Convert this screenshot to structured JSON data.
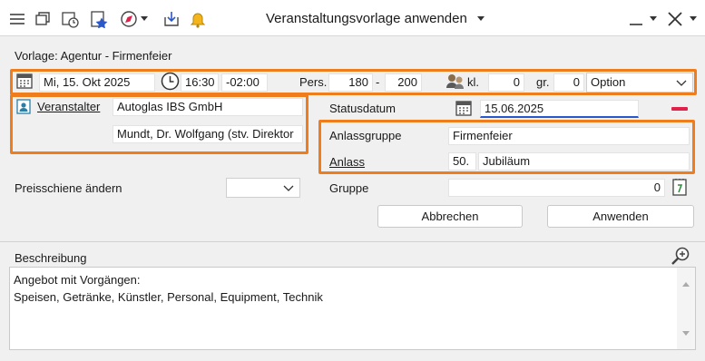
{
  "window": {
    "title": "Veranstaltungsvorlage anwenden"
  },
  "form": {
    "vorlage_label": "Vorlage: Agentur - Firmenfeier",
    "date": "Mi, 15. Okt 2025",
    "time": "16:30",
    "duration": "-02:00",
    "pers_label": "Pers.",
    "pers_min": "180",
    "pers_sep": "-",
    "pers_max": "200",
    "kl_label": "kl.",
    "kl_value": "0",
    "gr_label": "gr.",
    "gr_value": "0",
    "status_select": "Option",
    "veranstalter_label": "Veranstalter",
    "veranstalter_company": "Autoglas IBS GmbH",
    "veranstalter_contact": "Mundt, Dr. Wolfgang (stv. Direktor",
    "statusdatum_label": "Statusdatum",
    "statusdatum_value": "15.06.2025",
    "anlassgruppe_label": "Anlassgruppe",
    "anlassgruppe_value": "Firmenfeier",
    "anlass_label": "Anlass",
    "anlass_number": "50.",
    "anlass_value": "Jubiläum",
    "preisschiene_label": "Preisschiene ändern",
    "preisschiene_value": "",
    "gruppe_label": "Gruppe",
    "gruppe_value": "0"
  },
  "buttons": {
    "cancel": "Abbrechen",
    "apply": "Anwenden"
  },
  "beschreibung": {
    "label": "Beschreibung",
    "line1": "Angebot mit Vorgängen:",
    "line2": "Speisen, Getränke, Künstler, Personal, Equipment, Technik"
  },
  "colors": {
    "highlight": "#f07d1c",
    "accent_red": "#e0214a"
  },
  "icons": [
    "window-icon",
    "calendar-clock-icon",
    "star-page-icon",
    "compass-icon",
    "import-icon",
    "bell-icon",
    "calendar-icon",
    "clock-icon",
    "persons-icon",
    "contact-card-icon",
    "magnify-icon",
    "note-icon"
  ]
}
